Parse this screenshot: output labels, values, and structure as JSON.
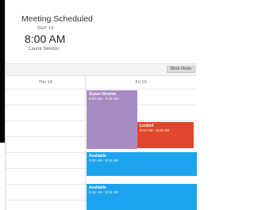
{
  "dialog": {
    "title": "Meeting Scheduled",
    "date": "SEP 15",
    "time": "8:00 AM",
    "person": "Laurie Newton"
  },
  "toolbar": {
    "more_button_label": "More Views"
  },
  "calendar": {
    "days": [
      {
        "label": "Thu 14"
      },
      {
        "label": "Fri 15"
      }
    ],
    "events": [
      {
        "name": "Susan Newton",
        "time": "8:00 AM - 9:45 AM",
        "color": "#a98bc4"
      },
      {
        "name": "Locked",
        "time": "9:15 AM - 9:45 AM",
        "color": "#e2472e"
      },
      {
        "name": "Available",
        "time": "8:00 AM - 8:15 AM",
        "color": "#1ea3ee"
      },
      {
        "name": "Available",
        "time": "9:15 AM - 9:15 AM",
        "color": "#1ea3ee"
      }
    ]
  }
}
